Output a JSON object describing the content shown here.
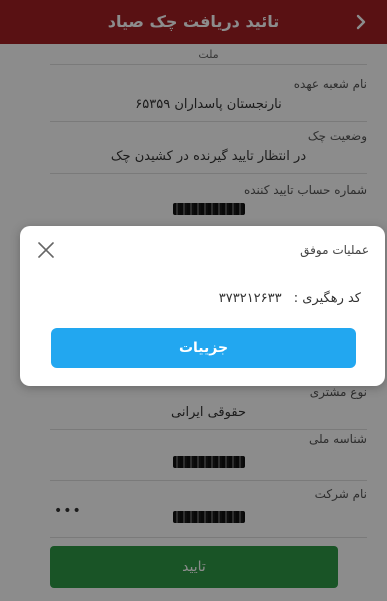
{
  "header": {
    "title": "تائید دریافت چک صیاد"
  },
  "fields": {
    "bank_value": "ملت",
    "branch_label": "نام شعبه عهده",
    "branch_value": "نارنجستان پاسداران ۶۵۳۵۹",
    "status_label": "وضعیت چک",
    "status_value": "در انتظار تایید گیرنده در کشیدن چک",
    "account_label": "شماره حساب تایید کننده",
    "person_type_label": "نوع مشتری",
    "person_type_value": "حقوقی ایرانی",
    "national_id_label": "شناسه ملی",
    "company_label": "نام شرکت",
    "company_dots": "•••"
  },
  "confirm_button": {
    "label": "تایید"
  },
  "dialog": {
    "title": "عملیات موفق",
    "tracking_label": "کد رهگیری :",
    "tracking_code": "۳۷۳۲۱۲۶۳۳",
    "details_button": "جزییات"
  },
  "colors": {
    "header": "#a31f24",
    "confirm": "#2e9a45",
    "details": "#22a7f0"
  }
}
